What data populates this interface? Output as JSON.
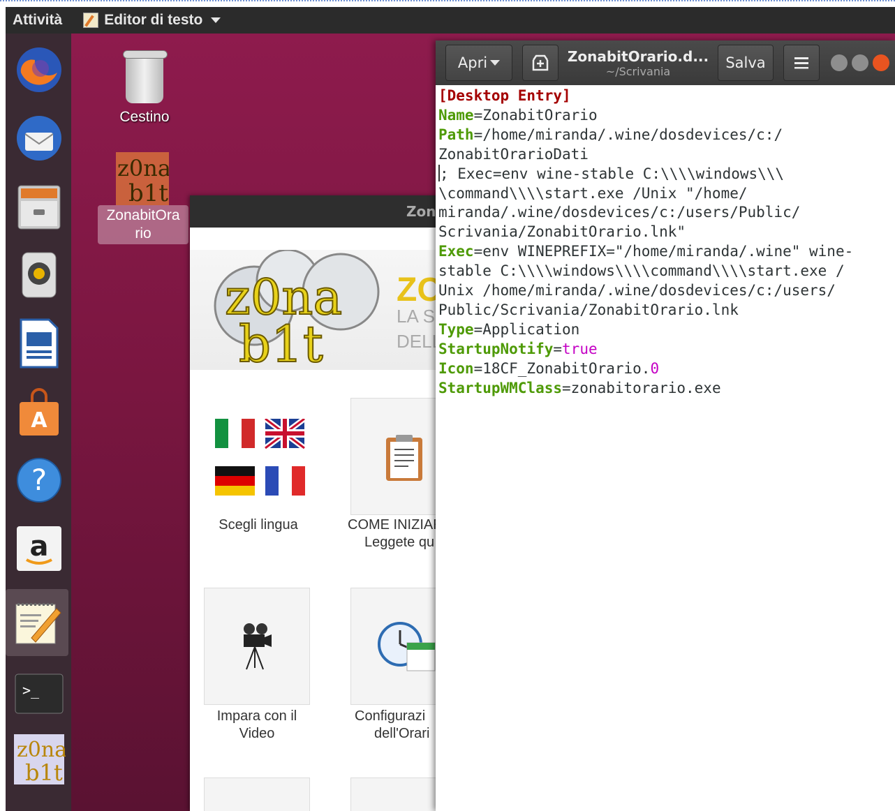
{
  "topbar": {
    "activities": "Attività",
    "app_menu": "Editor di testo"
  },
  "dock": {
    "items": [
      {
        "name": "firefox"
      },
      {
        "name": "thunderbird"
      },
      {
        "name": "files"
      },
      {
        "name": "rhythmbox"
      },
      {
        "name": "libreoffice-writer"
      },
      {
        "name": "ubuntu-software"
      },
      {
        "name": "help"
      },
      {
        "name": "amazon"
      },
      {
        "name": "text-editor"
      },
      {
        "name": "terminal"
      },
      {
        "name": "zonabit"
      }
    ]
  },
  "desktop": {
    "trash_label": "Cestino",
    "zonabit_label_line1": "ZonabitOra",
    "zonabit_label_line2": "rio"
  },
  "zonabit_window": {
    "title_fragment": "Zon",
    "logo_text_top": "z0na",
    "logo_text_bottom": "b1t",
    "banner_letters": "ZO",
    "banner_line2": "LA S",
    "banner_line3": "DELL",
    "tiles": [
      {
        "line1": "Scegli lingua",
        "line2": ""
      },
      {
        "line1": "COME INIZIAR",
        "line2": "Leggete qu"
      },
      {
        "line1": "Impara con il",
        "line2": "Video"
      },
      {
        "line1": "Configurazi",
        "line2": "dell'Orari"
      }
    ]
  },
  "editor": {
    "open_label": "Apri",
    "title": "ZonabitOrario.d...",
    "subtitle": "~/Scrivania",
    "save_label": "Salva",
    "lines": [
      {
        "k": "[Desktop Entry]"
      },
      {
        "k": "Name",
        "v": "=ZonabitOrario"
      },
      {
        "k": "Path",
        "v": "=/home/miranda/.wine/dosdevices/c:/"
      },
      {
        "t": "ZonabitOrarioDati"
      },
      {
        "t": "; Exec=env wine-stable C:\\\\\\\\windows\\\\\\"
      },
      {
        "t": "\\command\\\\\\\\start.exe /Unix \"/home/"
      },
      {
        "t": "miranda/.wine/dosdevices/c:/users/Public/"
      },
      {
        "t": "Scrivania/ZonabitOrario.lnk\""
      },
      {
        "k": "Exec",
        "v": "=env WINEPREFIX=\"/home/miranda/.wine\" wine-"
      },
      {
        "t": "stable C:\\\\\\\\windows\\\\\\\\command\\\\\\\\start.exe /"
      },
      {
        "t": "Unix /home/miranda/.wine/dosdevices/c:/users/"
      },
      {
        "t": "Public/Scrivania/ZonabitOrario.lnk"
      },
      {
        "k": "Type",
        "v": "=Application"
      },
      {
        "k": "StartupNotify",
        "v": "=",
        "b": "true"
      },
      {
        "k": "Icon",
        "v": "=18CF_ZonabitOrario.",
        "n": "0"
      },
      {
        "k": "StartupWMClass",
        "v": "=zonabitorario.exe"
      }
    ]
  }
}
